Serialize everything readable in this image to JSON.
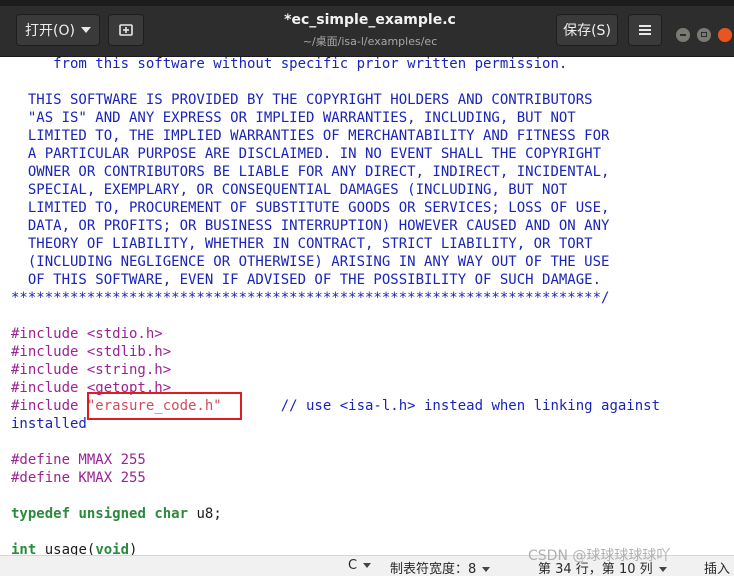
{
  "headerbar": {
    "open_label": "打开(O)",
    "title": "*ec_simple_example.c",
    "subtitle": "~/桌面/isa-l/examples/ec",
    "save_label": "保存(S)"
  },
  "code_lines": [
    [
      {
        "t": "     from this software without specific prior written permission.",
        "c": "comment"
      }
    ],
    [
      {
        "t": "",
        "c": "plain"
      }
    ],
    [
      {
        "t": "  THIS SOFTWARE IS PROVIDED BY THE COPYRIGHT HOLDERS AND CONTRIBUTORS",
        "c": "comment"
      }
    ],
    [
      {
        "t": "  \"AS IS\" AND ANY EXPRESS OR IMPLIED WARRANTIES, INCLUDING, BUT NOT",
        "c": "comment"
      }
    ],
    [
      {
        "t": "  LIMITED TO, THE IMPLIED WARRANTIES OF MERCHANTABILITY AND FITNESS FOR",
        "c": "comment"
      }
    ],
    [
      {
        "t": "  A PARTICULAR PURPOSE ARE DISCLAIMED. IN NO EVENT SHALL THE COPYRIGHT",
        "c": "comment"
      }
    ],
    [
      {
        "t": "  OWNER OR CONTRIBUTORS BE LIABLE FOR ANY DIRECT, INDIRECT, INCIDENTAL,",
        "c": "comment"
      }
    ],
    [
      {
        "t": "  SPECIAL, EXEMPLARY, OR CONSEQUENTIAL DAMAGES (INCLUDING, BUT NOT",
        "c": "comment"
      }
    ],
    [
      {
        "t": "  LIMITED TO, PROCUREMENT OF SUBSTITUTE GOODS OR SERVICES; LOSS OF USE,",
        "c": "comment"
      }
    ],
    [
      {
        "t": "  DATA, OR PROFITS; OR BUSINESS INTERRUPTION) HOWEVER CAUSED AND ON ANY",
        "c": "comment"
      }
    ],
    [
      {
        "t": "  THEORY OF LIABILITY, WHETHER IN CONTRACT, STRICT LIABILITY, OR TORT",
        "c": "comment"
      }
    ],
    [
      {
        "t": "  (INCLUDING NEGLIGENCE OR OTHERWISE) ARISING IN ANY WAY OUT OF THE USE",
        "c": "comment"
      }
    ],
    [
      {
        "t": "  OF THIS SOFTWARE, EVEN IF ADVISED OF THE POSSIBILITY OF SUCH DAMAGE.",
        "c": "comment"
      }
    ],
    [
      {
        "t": "**********************************************************************/",
        "c": "comment"
      }
    ],
    [
      {
        "t": "",
        "c": "plain"
      }
    ],
    [
      {
        "t": "#include ",
        "c": "pre"
      },
      {
        "t": "<stdio.h>",
        "c": "pre"
      }
    ],
    [
      {
        "t": "#include ",
        "c": "pre"
      },
      {
        "t": "<stdlib.h>",
        "c": "pre"
      }
    ],
    [
      {
        "t": "#include ",
        "c": "pre"
      },
      {
        "t": "<string.h>",
        "c": "pre"
      }
    ],
    [
      {
        "t": "#include ",
        "c": "pre"
      },
      {
        "t": "<getopt.h>",
        "c": "pre"
      }
    ],
    [
      {
        "t": "#include ",
        "c": "pre"
      },
      {
        "t": "\"erasure_code.h\"",
        "c": "str"
      },
      {
        "t": "       // use <isa-l.h> instead when linking against",
        "c": "comment"
      }
    ],
    [
      {
        "t": "installed",
        "c": "comment"
      }
    ],
    [
      {
        "t": "",
        "c": "plain"
      }
    ],
    [
      {
        "t": "#define MMAX 255",
        "c": "pre"
      }
    ],
    [
      {
        "t": "#define KMAX 255",
        "c": "pre"
      }
    ],
    [
      {
        "t": "",
        "c": "plain"
      }
    ],
    [
      {
        "t": "typedef",
        "c": "type"
      },
      {
        "t": " ",
        "c": "plain"
      },
      {
        "t": "unsigned",
        "c": "type"
      },
      {
        "t": " ",
        "c": "plain"
      },
      {
        "t": "char",
        "c": "type"
      },
      {
        "t": " u8;",
        "c": "plain"
      }
    ],
    [
      {
        "t": "",
        "c": "plain"
      }
    ],
    [
      {
        "t": "int",
        "c": "type"
      },
      {
        "t": " usage(",
        "c": "plain"
      },
      {
        "t": "void",
        "c": "type"
      },
      {
        "t": ")",
        "c": "plain"
      }
    ]
  ],
  "statusbar": {
    "language": "C",
    "tab_width": "制表符宽度：8",
    "position": "第 34 行，第 10 列",
    "insert_mode": "插入"
  },
  "watermark": "CSDN @球球球球球吖",
  "colors": {
    "comment": "#1a24b8",
    "preprocessor": "#9b2393",
    "string": "#d14b5b",
    "type": "#2b8a3e",
    "highlight_box": "#e01b24"
  }
}
